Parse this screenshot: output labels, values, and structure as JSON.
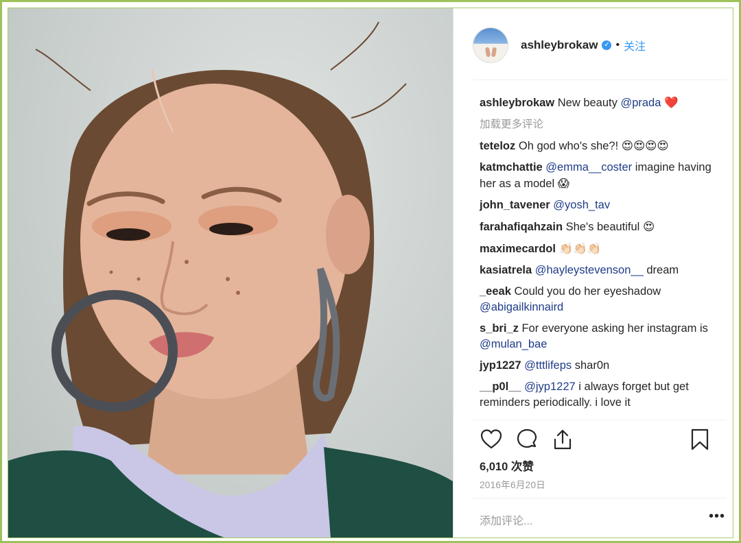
{
  "post": {
    "author": "ashleybrokaw",
    "verified_icon": "verified-badge-icon",
    "separator": "•",
    "follow_label": "关注"
  },
  "caption": {
    "username": "ashleybrokaw",
    "text": "New beauty ",
    "mention": "@prada",
    "emoji": "❤️"
  },
  "load_more_label": "加载更多评论",
  "comments": [
    {
      "user": "teteloz",
      "text": "Oh god who's she?! ",
      "mention": "",
      "after": "",
      "emoji": "😍😍😍😍"
    },
    {
      "user": "katmchattie",
      "text": "",
      "mention": "@emma__coster",
      "after": " imagine having her as a model ",
      "emoji": "😱"
    },
    {
      "user": "john_tavener",
      "text": "",
      "mention": "@yosh_tav",
      "after": "",
      "emoji": ""
    },
    {
      "user": "farahafiqahzain",
      "text": "She's beautiful ",
      "mention": "",
      "after": "",
      "emoji": "😍"
    },
    {
      "user": "maximecardol",
      "text": "",
      "mention": "",
      "after": "",
      "emoji": "👏🏻👏🏻👏🏻"
    },
    {
      "user": "kasiatrela",
      "text": "",
      "mention": "@hayleystevenson__",
      "after": " dream",
      "emoji": ""
    },
    {
      "user": "_eeak",
      "text": "Could you do her eyeshadow ",
      "mention": "@abigailkinnaird",
      "after": "",
      "emoji": ""
    },
    {
      "user": "s_bri_z",
      "text": "For everyone asking her instagram is ",
      "mention": "@mulan_bae",
      "after": "",
      "emoji": ""
    },
    {
      "user": "jyp1227",
      "text": "",
      "mention": "@tttlifeps",
      "after": " shar0n",
      "emoji": ""
    },
    {
      "user": "__p0l__",
      "text": "",
      "mention": "@jyp1227",
      "after": " i always forget but get reminders periodically. i love it",
      "emoji": ""
    }
  ],
  "likes_label": "6,010 次赞",
  "date_label": "2016年6月20日",
  "add_comment_placeholder": "添加评论...",
  "more_label": "•••",
  "colors": {
    "accent": "#3897f0",
    "mention": "#1f3c88",
    "frame": "#9dc25a"
  },
  "icons": [
    "heart-icon",
    "comment-icon",
    "share-icon",
    "bookmark-icon"
  ]
}
